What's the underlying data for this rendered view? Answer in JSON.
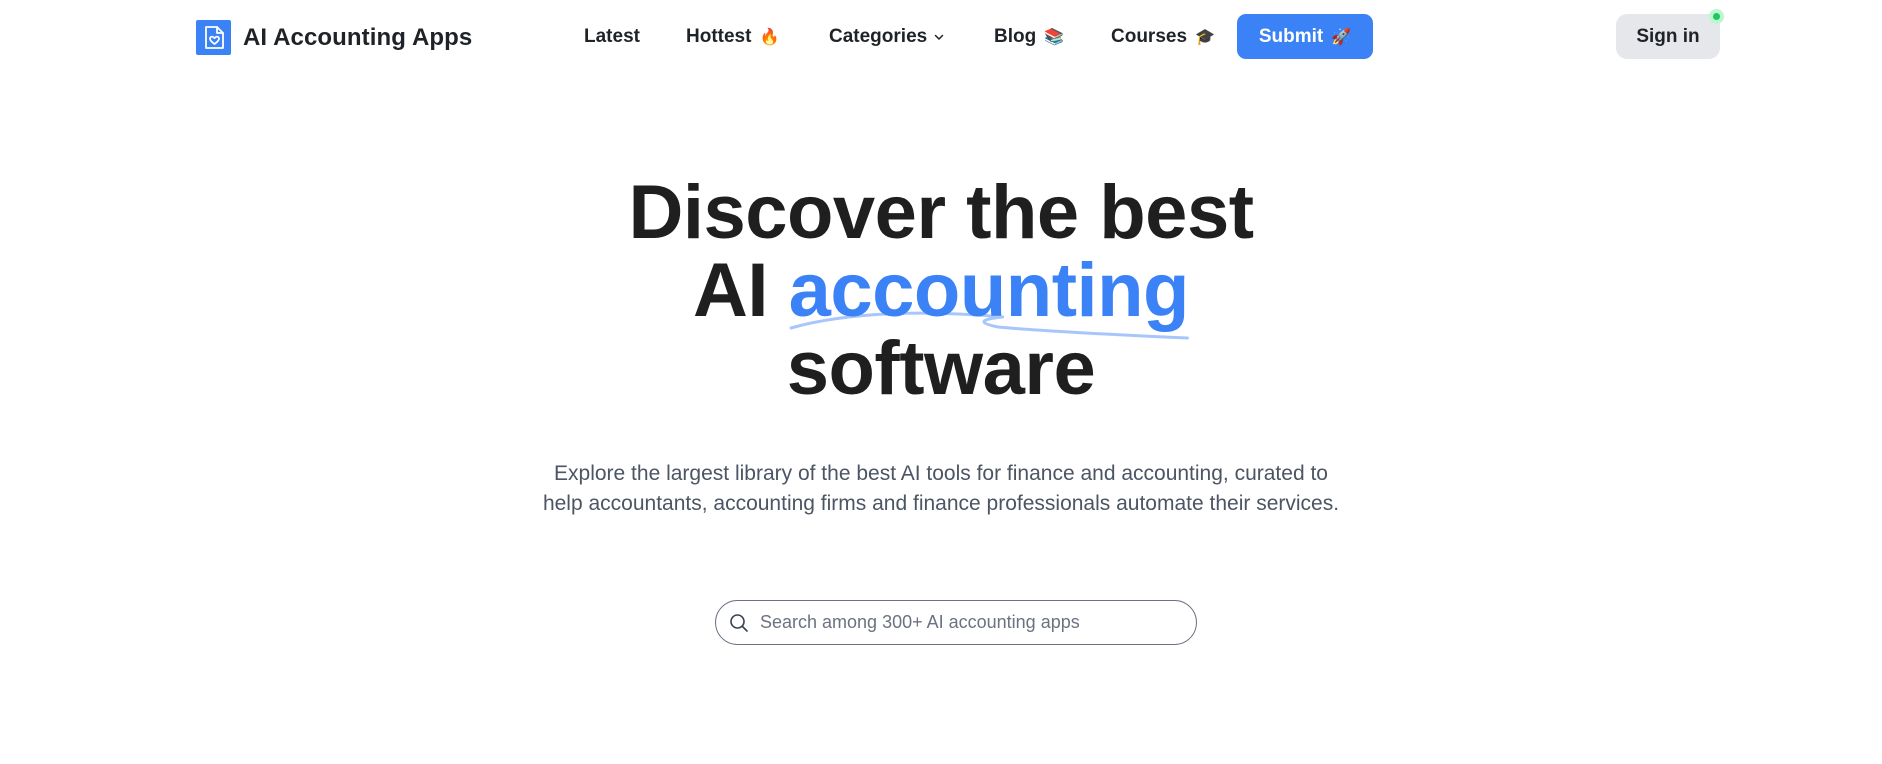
{
  "brand": {
    "name": "AI Accounting Apps",
    "logo_icon": "document-heart-icon",
    "accent": "#3b82f6"
  },
  "nav": {
    "latest": "Latest",
    "hottest": "Hottest",
    "hottest_emoji": "🔥",
    "categories": "Categories",
    "blog": "Blog",
    "blog_emoji": "📚",
    "courses": "Courses",
    "courses_emoji": "🎓"
  },
  "submit": {
    "label": "Submit",
    "emoji": "🚀"
  },
  "signin": {
    "label": "Sign in"
  },
  "hero": {
    "line1": "Discover the best",
    "line2_prefix": "AI",
    "line2_accent": "accounting",
    "line3": "software",
    "subtitle": "Explore the largest library of the best AI tools for finance and accounting, curated to help accountants, accounting firms and finance professionals automate their services."
  },
  "search": {
    "placeholder": "Search among 300+ AI accounting apps",
    "value": ""
  },
  "colors": {
    "primary": "#3b82f6",
    "signin_bg": "#e6e7ea",
    "online": "#22c55e",
    "text": "#1f2328",
    "muted": "#4b5563"
  }
}
